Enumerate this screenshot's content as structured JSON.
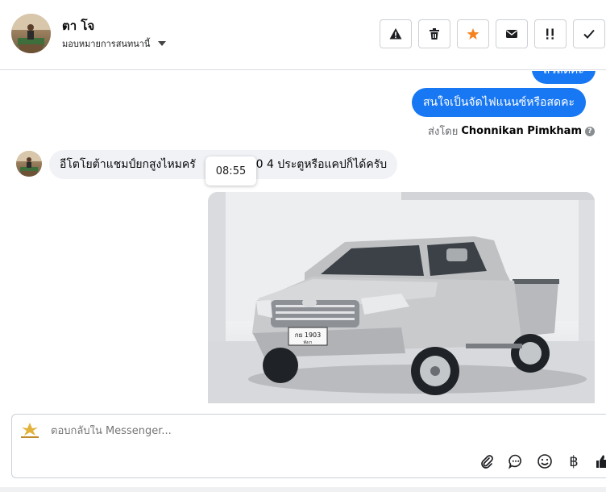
{
  "header": {
    "contact_name": "ตา โจ",
    "assign_label": "มอบหมายการสนทนานี้",
    "tool_buttons": [
      {
        "icon": "alert-triangle-icon",
        "color": "#1c1e21"
      },
      {
        "icon": "trash-icon",
        "color": "#1c1e21"
      },
      {
        "icon": "star-icon",
        "color": "#f5821f"
      },
      {
        "icon": "envelope-icon",
        "color": "#1c1e21"
      },
      {
        "icon": "priority-icon",
        "color": "#1c1e21"
      },
      {
        "icon": "check-icon",
        "color": "#1c1e21"
      }
    ]
  },
  "chat": {
    "outgoing_partial": "สวัสดีคะ",
    "outgoing_message": "สนใจเป็นจัดไฟแนนซ์หรือสดคะ",
    "sent_by_prefix": "ส่งโดย",
    "sent_by_name": "Chonnikan Pimkham",
    "incoming_before": "อีโตโยต้าแชมป์ยกสูงไหมครั",
    "incoming_after": "500 4 ประตูหรือแคปก็ได้ครับ",
    "timestamp_tooltip": "08:55",
    "photo": {
      "plate_top": "กย 1903",
      "plate_bottom": "พังงา"
    },
    "accent_color": "#1877f2"
  },
  "composer": {
    "placeholder": "ตอบกลับใน Messenger...",
    "currency_symbol": "฿"
  }
}
